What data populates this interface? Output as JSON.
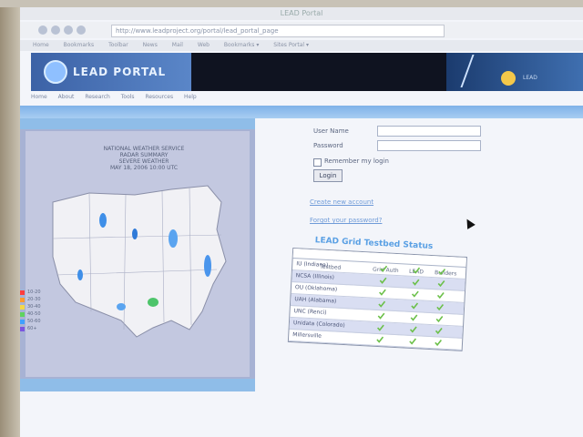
{
  "browser": {
    "title": "LEAD Portal",
    "address": "http://www.leadproject.org/portal/lead_portal_page",
    "bookmarks": [
      "Home",
      "Bookmarks",
      "Toolbar",
      "News",
      "Mail",
      "Web",
      "Bookmarks ▾",
      "Sites Portal ▾"
    ]
  },
  "banner": {
    "logo_text": "LEAD PORTAL",
    "right_text": "LEAD"
  },
  "subnav": [
    "Home",
    "About",
    "Research",
    "Tools",
    "Resources",
    "Help"
  ],
  "map": {
    "heading_lines": [
      "NATIONAL WEATHER SERVICE",
      "RADAR SUMMARY",
      "SEVERE WEATHER",
      "MAY 18, 2006 10:00 UTC"
    ],
    "legend": [
      {
        "label": "10-20",
        "color": "#ff3d3d"
      },
      {
        "label": "20-30",
        "color": "#ff9a2e"
      },
      {
        "label": "30-40",
        "color": "#f4d84a"
      },
      {
        "label": "40-50",
        "color": "#5fd35f"
      },
      {
        "label": "50-60",
        "color": "#3fa0ff"
      },
      {
        "label": "60+",
        "color": "#7a55e0"
      }
    ]
  },
  "login": {
    "username_label": "User Name",
    "password_label": "Password",
    "remember_label": "Remember my login",
    "login_button": "Login",
    "create_account": "Create new account",
    "forgot_password": "Forgot your password?"
  },
  "status": {
    "title": "LEAD Grid Testbed Status",
    "columns": [
      "Testbed",
      "Grid Auth",
      "LEAD",
      "Builders"
    ],
    "rows": [
      {
        "name": "IU (Indiana)",
        "checks": [
          true,
          true,
          true
        ]
      },
      {
        "name": "NCSA (Illinois)",
        "checks": [
          true,
          true,
          true
        ]
      },
      {
        "name": "OU (Oklahoma)",
        "checks": [
          true,
          true,
          true
        ]
      },
      {
        "name": "UAH (Alabama)",
        "checks": [
          true,
          true,
          true
        ]
      },
      {
        "name": "UNC (Renci)",
        "checks": [
          true,
          true,
          true
        ]
      },
      {
        "name": "Unidata (Colorado)",
        "checks": [
          true,
          true,
          true
        ]
      },
      {
        "name": "Millersville",
        "checks": [
          true,
          true,
          true
        ]
      }
    ]
  },
  "colors": {
    "accent": "#5aa0e4",
    "check": "#6cc04a"
  }
}
